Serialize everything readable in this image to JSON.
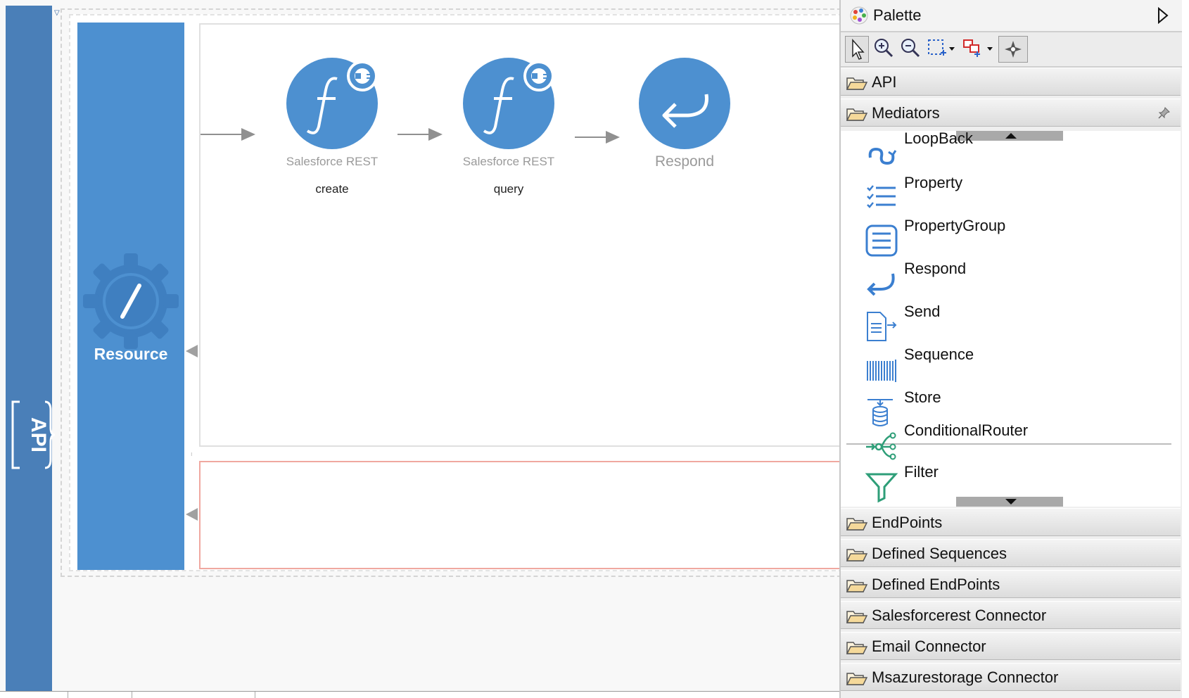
{
  "canvas": {
    "api_label": "API",
    "resource_label": "Resource",
    "mediators": [
      {
        "type": "Salesforce REST",
        "name": "create"
      },
      {
        "type": "Salesforce REST",
        "name": "query"
      },
      {
        "type": "Respond",
        "name": ""
      }
    ],
    "colors": {
      "api_bar": "#4a7fb8",
      "resource": "#4d90d0",
      "fault_border": "#f0a8a0"
    }
  },
  "palette": {
    "title": "Palette",
    "toolbar": [
      "select-tool",
      "zoom-in-tool",
      "zoom-out-tool",
      "marquee-tool",
      "connection-tool",
      "snap-tool"
    ],
    "drawers": {
      "api": "API",
      "mediators": "Mediators",
      "endpoints": "EndPoints",
      "defined_sequences": "Defined Sequences",
      "defined_endpoints": "Defined EndPoints",
      "salesforcerest_connector": "Salesforcerest Connector",
      "email_connector": "Email Connector",
      "msazurestorage_connector": "Msazurestorage Connector"
    },
    "mediator_items": [
      {
        "label": "LoopBack",
        "icon": "loopback-icon"
      },
      {
        "label": "Property",
        "icon": "property-icon"
      },
      {
        "label": "PropertyGroup",
        "icon": "property-group-icon"
      },
      {
        "label": "Respond",
        "icon": "respond-icon"
      },
      {
        "label": "Send",
        "icon": "send-icon"
      },
      {
        "label": "Sequence",
        "icon": "sequence-icon"
      },
      {
        "label": "Store",
        "icon": "store-icon"
      },
      {
        "label": "ConditionalRouter",
        "icon": "conditional-router-icon"
      },
      {
        "label": "Filter",
        "icon": "filter-icon"
      }
    ]
  }
}
